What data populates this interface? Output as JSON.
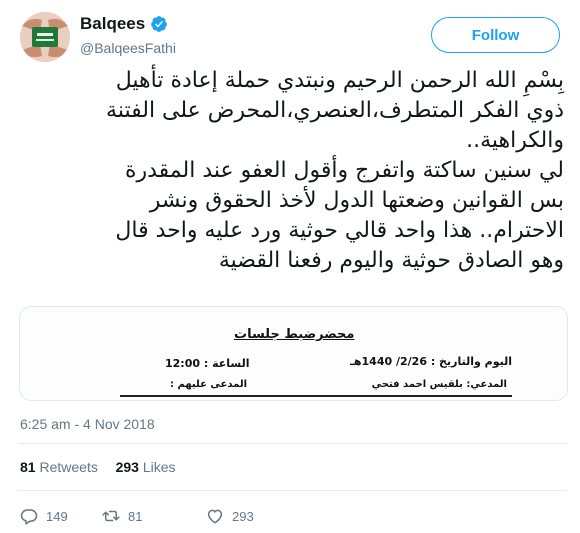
{
  "user": {
    "name": "Balqees",
    "handle": "@BalqeesFathi"
  },
  "follow_label": "Follow",
  "tweet_lines": [
    "بِسْمِ الله الرحمن الرحيم ونبتدي حملة إعادة تأهيل",
    "ذوي الفكر المتطرف،العنصري،المحرض على الفتنة",
    "والكراهية..",
    "لي سنين ساكتة واتفرج وأقول العفو عند المقدرة",
    "بس القوانين وضعتها الدول لأخذ الحقوق ونشر",
    "الاحترام.. هذا واحد قالي حوثية ورد عليه واحد قال",
    "وهو الصادق حوثية واليوم رفعنا القضية"
  ],
  "document": {
    "title": "محضرضبط جلسات",
    "day_date": "اليوم والتاريخ  :  2/26/ 1440هـ",
    "hour": "الساعة :  12:00",
    "plaintiff": "المدعي: بلقيس احمد فتحي",
    "defendant": "المدعى عليهم :"
  },
  "timestamp": "6:25 am - 4 Nov 2018",
  "stats": {
    "retweets_count": "81",
    "retweets_label": "Retweets",
    "likes_count": "293",
    "likes_label": "Likes"
  },
  "actions": {
    "replies": "149",
    "retweets": "81",
    "likes": "293"
  },
  "colors": {
    "accent": "#1da1f2",
    "muted": "#657786",
    "text": "#14171a"
  },
  "icons": [
    "avatar-flag-image",
    "verified-badge-icon",
    "reply-icon",
    "retweet-icon",
    "like-icon"
  ]
}
